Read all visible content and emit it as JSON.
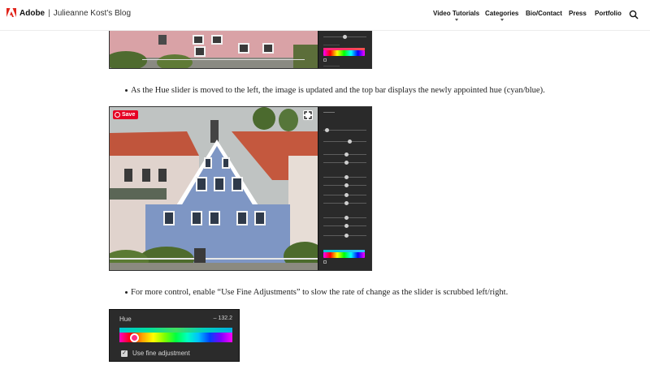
{
  "header": {
    "brand": "Adobe",
    "separator": "|",
    "blog_title": "Julieanne Kost's Blog",
    "nav": [
      {
        "label": "Video Tutorials",
        "has_dropdown": true
      },
      {
        "label": "Categories",
        "has_dropdown": true
      },
      {
        "label": "Bio/Contact",
        "has_dropdown": false
      },
      {
        "label": "Press",
        "has_dropdown": false
      },
      {
        "label": "Portfolio",
        "has_dropdown": false
      }
    ],
    "search_icon": "search-icon"
  },
  "content": {
    "bullet_1": "As the Hue slider is moved to the left, the image is updated and the top bar displays the  newly appointed hue (cyan/blue).",
    "bullet_2": "For more control, enable “Use Fine Adjustments” to slow the rate of change as the slider is scrubbed left/right.",
    "save_label": "Save"
  },
  "hue_panel": {
    "label": "Hue",
    "value": "– 132.2",
    "slider_position": 0.13,
    "fine_adjustment_checked": true,
    "fine_adjustment_label": "Use fine adjustment"
  },
  "colors": {
    "house_pink": "#d9a2a6",
    "house_blue": "#7e96c4",
    "roof": "#c0553c",
    "save_red": "#e60023"
  }
}
